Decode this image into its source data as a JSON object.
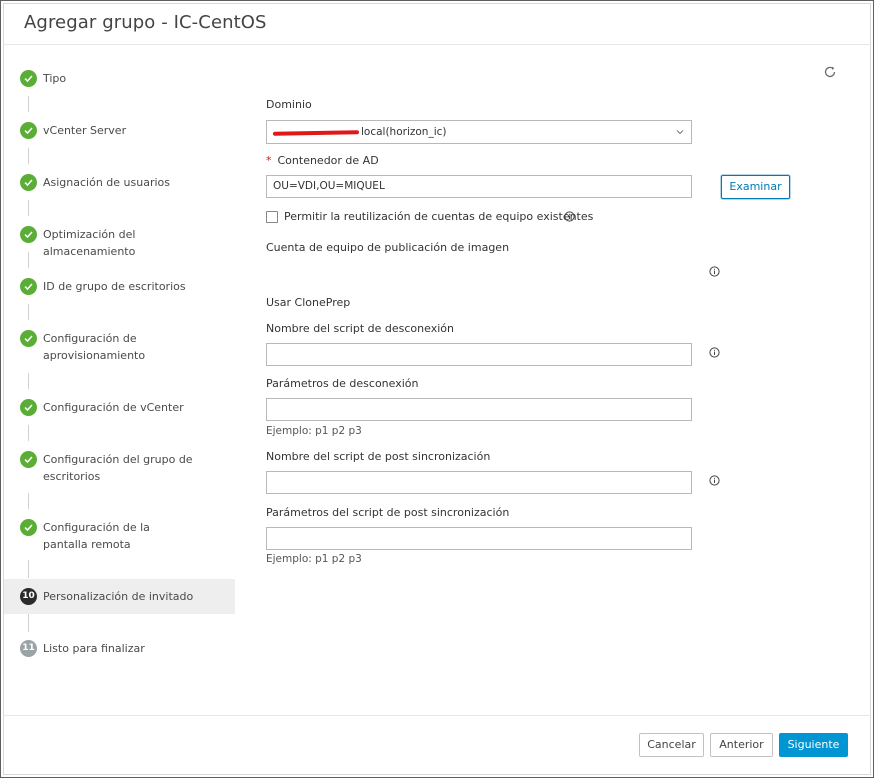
{
  "dialog": {
    "title": "Agregar grupo - IC-CentOS"
  },
  "steps": [
    {
      "number": "1",
      "label": "Tipo",
      "status": "done"
    },
    {
      "number": "2",
      "label": "vCenter Server",
      "status": "done"
    },
    {
      "number": "3",
      "label": "Asignación de usuarios",
      "status": "done"
    },
    {
      "number": "4",
      "label": "Optimización del almacenamiento",
      "status": "done"
    },
    {
      "number": "5",
      "label": "ID de grupo de escritorios",
      "status": "done"
    },
    {
      "number": "6",
      "label": "Configuración de aprovisionamiento",
      "status": "done"
    },
    {
      "number": "7",
      "label": "Configuración de vCenter",
      "status": "done"
    },
    {
      "number": "8",
      "label": "Configuración del grupo de escritorios",
      "status": "done"
    },
    {
      "number": "9",
      "label": "Configuración de la pantalla remota",
      "status": "done"
    },
    {
      "number": "10",
      "label": "Personalización de invitado",
      "status": "current"
    },
    {
      "number": "11",
      "label": "Listo para finalizar",
      "status": "pending"
    }
  ],
  "form": {
    "domain_label": "Dominio",
    "domain_value": "local(horizon_ic)",
    "ad_container_label": "Contenedor de AD",
    "ad_container_value": "OU=VDI,OU=MIQUEL",
    "browse_button": "Examinar",
    "reuse_accounts_label": "Permitir la reutilización de cuentas de equipo existentes",
    "image_publishing_label": "Cuenta de equipo de publicación de imagen",
    "cloneprep_label": "Usar ClonePrep",
    "poweroff_script_label": "Nombre del script de desconexión",
    "poweroff_script_value": "",
    "poweroff_params_label": "Parámetros de desconexión",
    "poweroff_params_value": "",
    "poweroff_params_hint": "Ejemplo: p1 p2 p3",
    "postsync_script_label": "Nombre del script de post sincronización",
    "postsync_script_value": "",
    "postsync_params_label": "Parámetros del script de post sincronización",
    "postsync_params_value": "",
    "postsync_params_hint": "Ejemplo: p1 p2 p3"
  },
  "footer": {
    "cancel": "Cancelar",
    "previous": "Anterior",
    "next": "Siguiente"
  },
  "colors": {
    "done": "#5aae36",
    "current": "#2b2b2b",
    "pending": "#9aa3a7",
    "primary": "#0095d3"
  }
}
